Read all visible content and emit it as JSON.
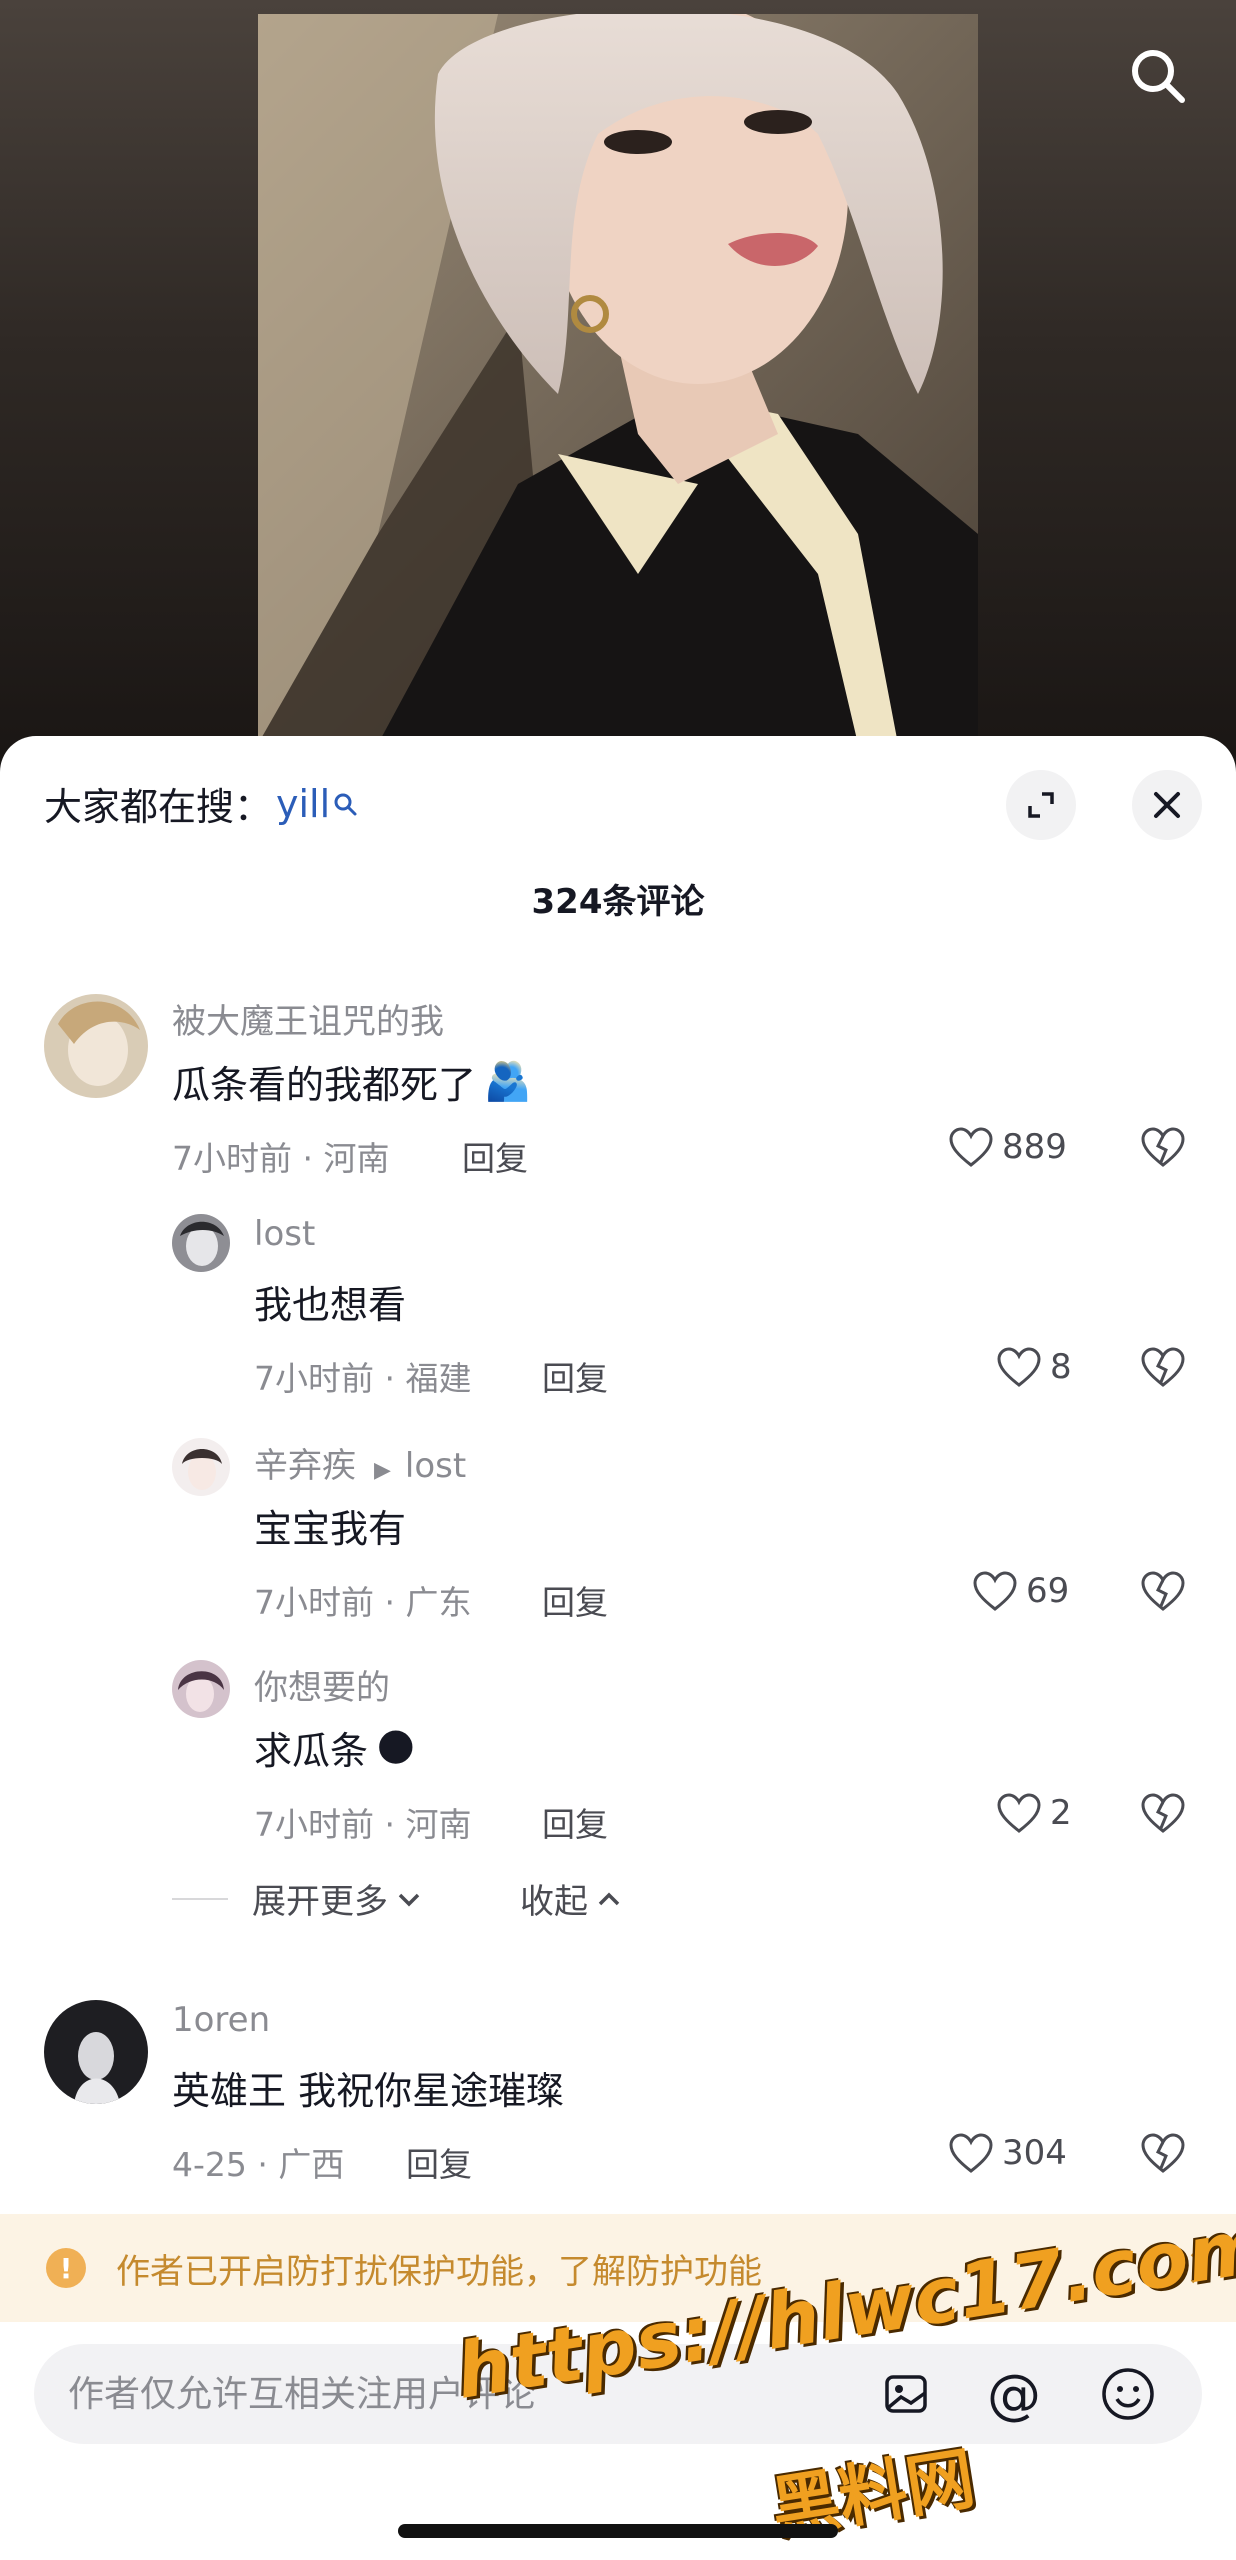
{
  "search_bar": {
    "prefix": "大家都在搜：",
    "keyword": "yill"
  },
  "comment_count": "324条评论",
  "comments": [
    {
      "user": "被大魔王诅咒的我",
      "text": "瓜条看的我都死了",
      "emoji": "🫂",
      "time_loc": "7小时前 · 河南",
      "reply": "回复",
      "likes": "889",
      "avatar_color": "#c9b79a"
    },
    {
      "user": "lost",
      "text": "我也想看",
      "time_loc": "7小时前 · 福建",
      "reply": "回复",
      "likes": "8",
      "avatar_color": "#6b6b70"
    },
    {
      "user": "辛弃疾",
      "reply_to": "lost",
      "text": "宝宝我有",
      "time_loc": "7小时前 · 广东",
      "reply": "回复",
      "likes": "69",
      "avatar_color": "#e8dcd8"
    },
    {
      "user": "你想要的",
      "text": "求瓜条",
      "emoji": "🌑",
      "time_loc": "7小时前 · 河南",
      "reply": "回复",
      "likes": "2",
      "avatar_color": "#b39aa8"
    },
    {
      "user": "1oren",
      "text": "英雄王 我祝你星途璀璨",
      "time_loc": "4-25 · 广西",
      "reply": "回复",
      "likes": "304",
      "avatar_color": "#1e1e22"
    }
  ],
  "expand_more": "展开更多",
  "collapse": "收起",
  "protection": "作者已开启防打扰保护功能，了解防护功能",
  "input_placeholder": "作者仅允许互相关注用户评论",
  "at_symbol": "@",
  "watermark": {
    "url": "https://hlwc17.com",
    "name": "黑料网"
  },
  "colors": {
    "accent_link": "#2b5db8",
    "banner_text": "#c58a2e",
    "banner_bg": "#fcf3e4"
  }
}
